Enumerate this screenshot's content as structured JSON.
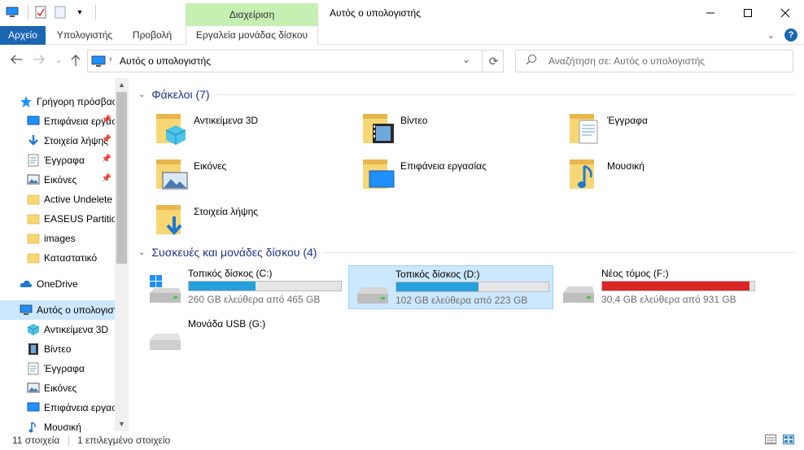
{
  "window": {
    "title": "Αυτός ο υπολογιστής",
    "context_tab_group": "Διαχείριση"
  },
  "ribbon": {
    "tabs": [
      {
        "label": "Αρχείο"
      },
      {
        "label": "Υπολογιστής"
      },
      {
        "label": "Προβολή"
      },
      {
        "label": "Εργαλεία μονάδας δίσκου"
      }
    ]
  },
  "address": {
    "path": "Αυτός ο υπολογιστής",
    "search_placeholder": "Αναζήτηση σε: Αυτός ο υπολογιστής"
  },
  "sidebar": {
    "items": [
      {
        "label": "Γρήγορη πρόσβαση",
        "icon": "star-icon",
        "pinned": false
      },
      {
        "label": "Επιφάνεια εργασίας",
        "icon": "desktop-icon",
        "pinned": true
      },
      {
        "label": "Στοιχεία λήψης",
        "icon": "download-icon",
        "pinned": true
      },
      {
        "label": "Έγγραφα",
        "icon": "documents-icon",
        "pinned": true
      },
      {
        "label": "Εικόνες",
        "icon": "pictures-icon",
        "pinned": true
      },
      {
        "label": "Active Undelete",
        "icon": "folder-icon",
        "pinned": false
      },
      {
        "label": "EASEUS Partition",
        "icon": "folder-icon",
        "pinned": false
      },
      {
        "label": "images",
        "icon": "folder-icon",
        "pinned": false
      },
      {
        "label": "Καταστατικό",
        "icon": "folder-icon",
        "pinned": false
      },
      {
        "label": "OneDrive",
        "icon": "cloud-icon",
        "pinned": false
      },
      {
        "label": "Αυτός ο υπολογιστής",
        "icon": "computer-icon",
        "pinned": false
      },
      {
        "label": "Αντικείμενα 3D",
        "icon": "cube-icon",
        "pinned": false
      },
      {
        "label": "Βίντεο",
        "icon": "video-icon",
        "pinned": false
      },
      {
        "label": "Έγγραφα",
        "icon": "documents-icon",
        "pinned": false
      },
      {
        "label": "Εικόνες",
        "icon": "pictures-icon",
        "pinned": false
      },
      {
        "label": "Επιφάνεια εργασίας",
        "icon": "desktop-icon",
        "pinned": false
      },
      {
        "label": "Μουσική",
        "icon": "music-icon",
        "pinned": false
      }
    ]
  },
  "folders_group": {
    "title": "Φάκελοι (7)",
    "items": [
      {
        "label": "Αντικείμενα 3D",
        "icon": "cube-icon"
      },
      {
        "label": "Βίντεο",
        "icon": "video-icon"
      },
      {
        "label": "Έγγραφα",
        "icon": "documents-icon"
      },
      {
        "label": "Εικόνες",
        "icon": "pictures-icon"
      },
      {
        "label": "Επιφάνεια εργασίας",
        "icon": "desktop-icon"
      },
      {
        "label": "Μουσική",
        "icon": "music-icon"
      },
      {
        "label": "Στοιχεία λήψης",
        "icon": "download-icon"
      }
    ]
  },
  "drives_group": {
    "title": "Συσκευές και μονάδες δίσκου (4)",
    "items": [
      {
        "name": "Τοπικός δίσκος (C:)",
        "free": "260 GB ελεύθερα από 465 GB",
        "used_fraction": 0.44,
        "has_bar": true
      },
      {
        "name": "Τοπικός δίσκος (D:)",
        "free": "102 GB ελεύθερα από 223 GB",
        "used_fraction": 0.54,
        "has_bar": true
      },
      {
        "name": "Νέος τόμος (F:)",
        "free": "30,4 GB ελεύθερα από 931 GB",
        "used_fraction": 0.97,
        "has_bar": true
      },
      {
        "name": "Μονάδα USB (G:)",
        "free": "",
        "used_fraction": 0,
        "has_bar": false
      }
    ]
  },
  "status": {
    "count": "11 στοιχεία",
    "selected": "1 επιλεγμένο στοιχείο"
  },
  "colors": {
    "accent": "#1a66b3",
    "selection": "#cce8ff",
    "bar_normal": "#26a0da",
    "bar_full": "#da2626",
    "context_tab": "#c6efb3",
    "group_title": "#1e3287"
  }
}
